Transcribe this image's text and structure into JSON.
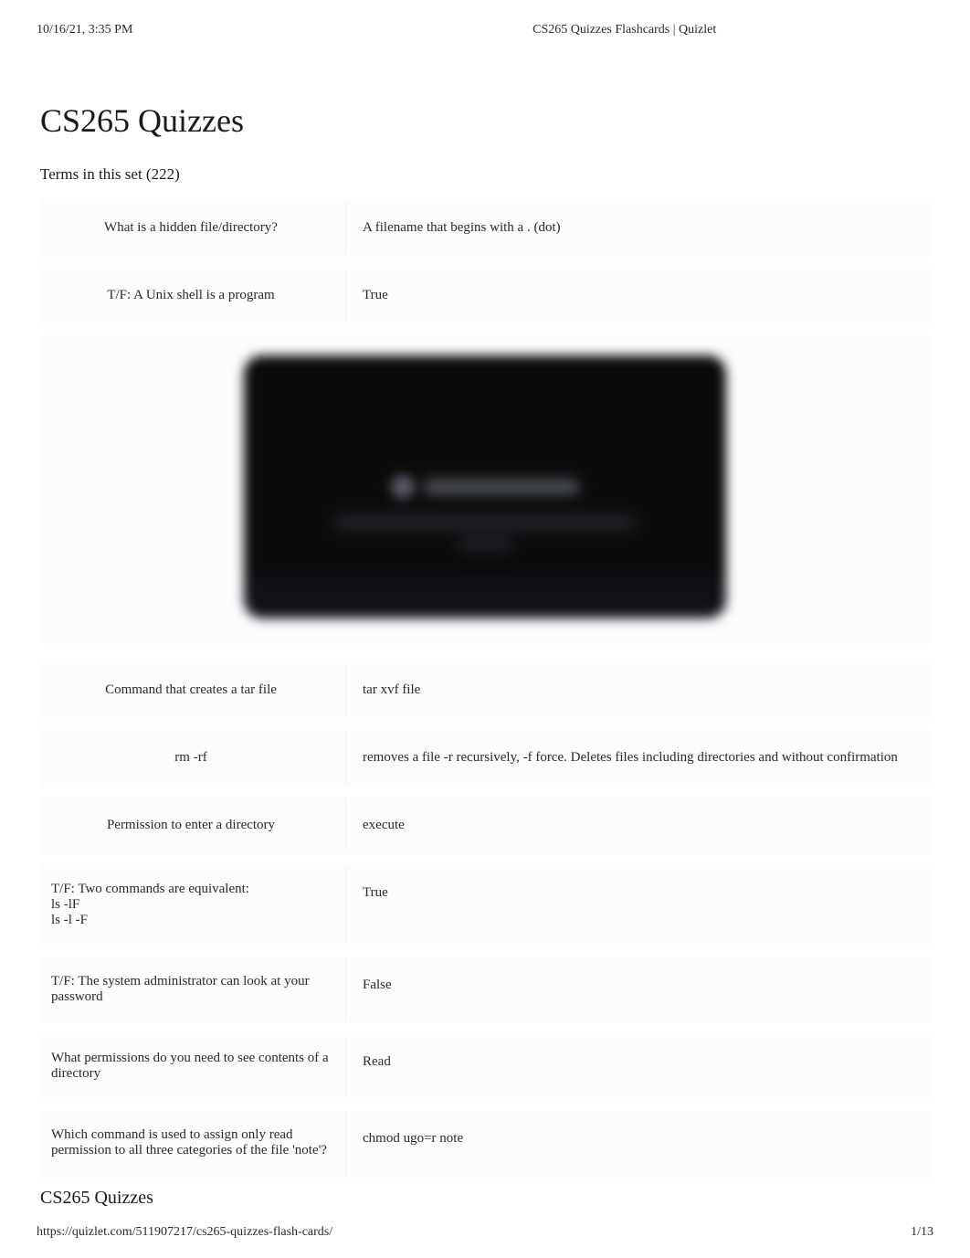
{
  "header": {
    "timestamp": "10/16/21, 3:35 PM",
    "docTitle": "CS265 Quizzes Flashcards | Quizlet"
  },
  "page": {
    "title": "CS265 Quizzes",
    "subtitle": "Terms in this set (222)"
  },
  "cards_top": [
    {
      "term": "What is a hidden file/directory?",
      "definition": "A filename that begins with a . (dot)",
      "centered": true
    },
    {
      "term": "T/F: A Unix shell is a program",
      "definition": "True",
      "centered": true
    }
  ],
  "cards_bottom": [
    {
      "term": "Command that creates a tar file",
      "definition": "tar xvf file",
      "centered": true
    },
    {
      "term": "rm -rf",
      "definition": "removes a file -r recursively, -f force. Deletes files including directories and without confirmation",
      "centered": true
    },
    {
      "term": "Permission to enter a directory",
      "definition": "execute",
      "centered": true
    },
    {
      "term": "T/F: Two commands are equivalent:\nls -lF\nls -l -F",
      "definition": "True",
      "centered": false
    },
    {
      "term": "T/F: The system administrator can look at your password",
      "definition": "False",
      "centered": false
    },
    {
      "term": "What permissions do you need to see contents of a directory",
      "definition": "Read",
      "centered": false
    },
    {
      "term": "Which command is used to assign only read permission to all three categories of the file 'note'?",
      "definition": "chmod ugo=r note",
      "centered": false
    }
  ],
  "stickyTitle": "CS265 Quizzes",
  "footer": {
    "url": "https://quizlet.com/511907217/cs265-quizzes-flash-cards/",
    "pagination": "1/13"
  }
}
